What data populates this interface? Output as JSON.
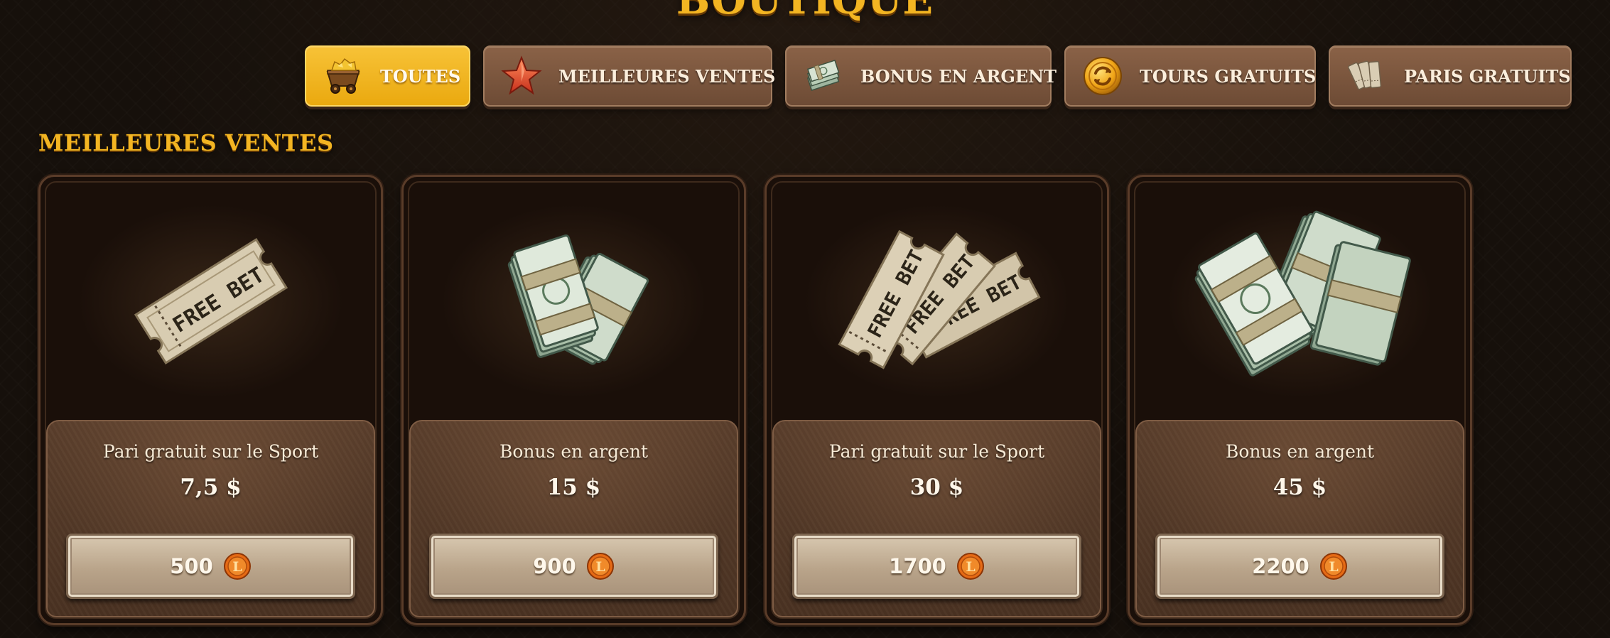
{
  "page_title": "BOUTIQUE",
  "tabs": [
    {
      "label": "TOUTES",
      "icon": "mine-cart-icon",
      "active": true
    },
    {
      "label": "MEILLEURES VENTES",
      "icon": "star-icon",
      "active": false
    },
    {
      "label": "BONUS EN ARGENT",
      "icon": "cash-bundle-icon",
      "active": false
    },
    {
      "label": "TOURS GRATUITS",
      "icon": "gold-spin-coin-icon",
      "active": false
    },
    {
      "label": "PARIS GRATUITS",
      "icon": "tickets-icon",
      "active": false
    }
  ],
  "section": {
    "title": "MEILLEURES VENTES",
    "cards": [
      {
        "name": "Pari gratuit sur le Sport",
        "price": "7,5 $",
        "cost": "500",
        "image": "free-bet-ticket-icon",
        "image_text": "FREE BET"
      },
      {
        "name": "Bonus en argent",
        "price": "15 $",
        "cost": "900",
        "image": "cash-stack-icon"
      },
      {
        "name": "Pari gratuit sur le Sport",
        "price": "30 $",
        "cost": "1700",
        "image": "free-bet-tickets-icon",
        "image_text": "FREE BET"
      },
      {
        "name": "Bonus en argent",
        "price": "45 $",
        "cost": "2200",
        "image": "large-cash-stack-icon"
      }
    ]
  },
  "colors": {
    "accent": "#f3b522",
    "tab_bg": "#7a5640",
    "tab_active_bg": "#f2b62a",
    "background": "#16100b"
  },
  "coin_icon": "coin-l-icon",
  "coin_letter": "L"
}
